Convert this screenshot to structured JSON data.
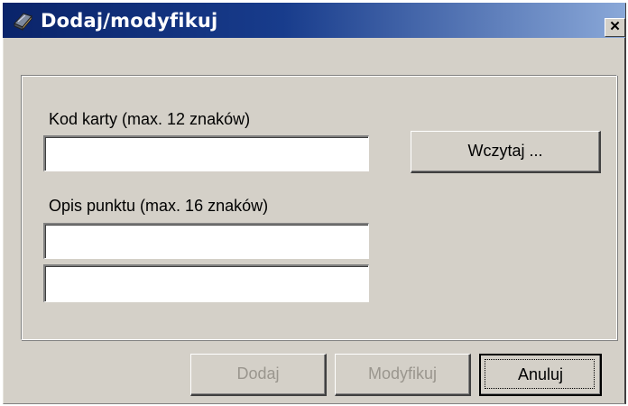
{
  "window": {
    "title": "Dodaj/modyfikuj",
    "title_icon": "book-icon",
    "close_label": "✕"
  },
  "form": {
    "card_code_label": "Kod karty (max. 12 znaków)",
    "card_code_value": "",
    "description_label": "Opis punktu (max. 16 znaków)",
    "description_line1_value": "",
    "description_line2_value": "",
    "load_button": "Wczytaj ..."
  },
  "actions": {
    "add": "Dodaj",
    "modify": "Modyfikuj",
    "cancel": "Anuluj"
  },
  "colors": {
    "title_bar_start": "#0a246a",
    "title_bar_end": "#8aa8d8",
    "dialog_face": "#d4d0c8"
  }
}
